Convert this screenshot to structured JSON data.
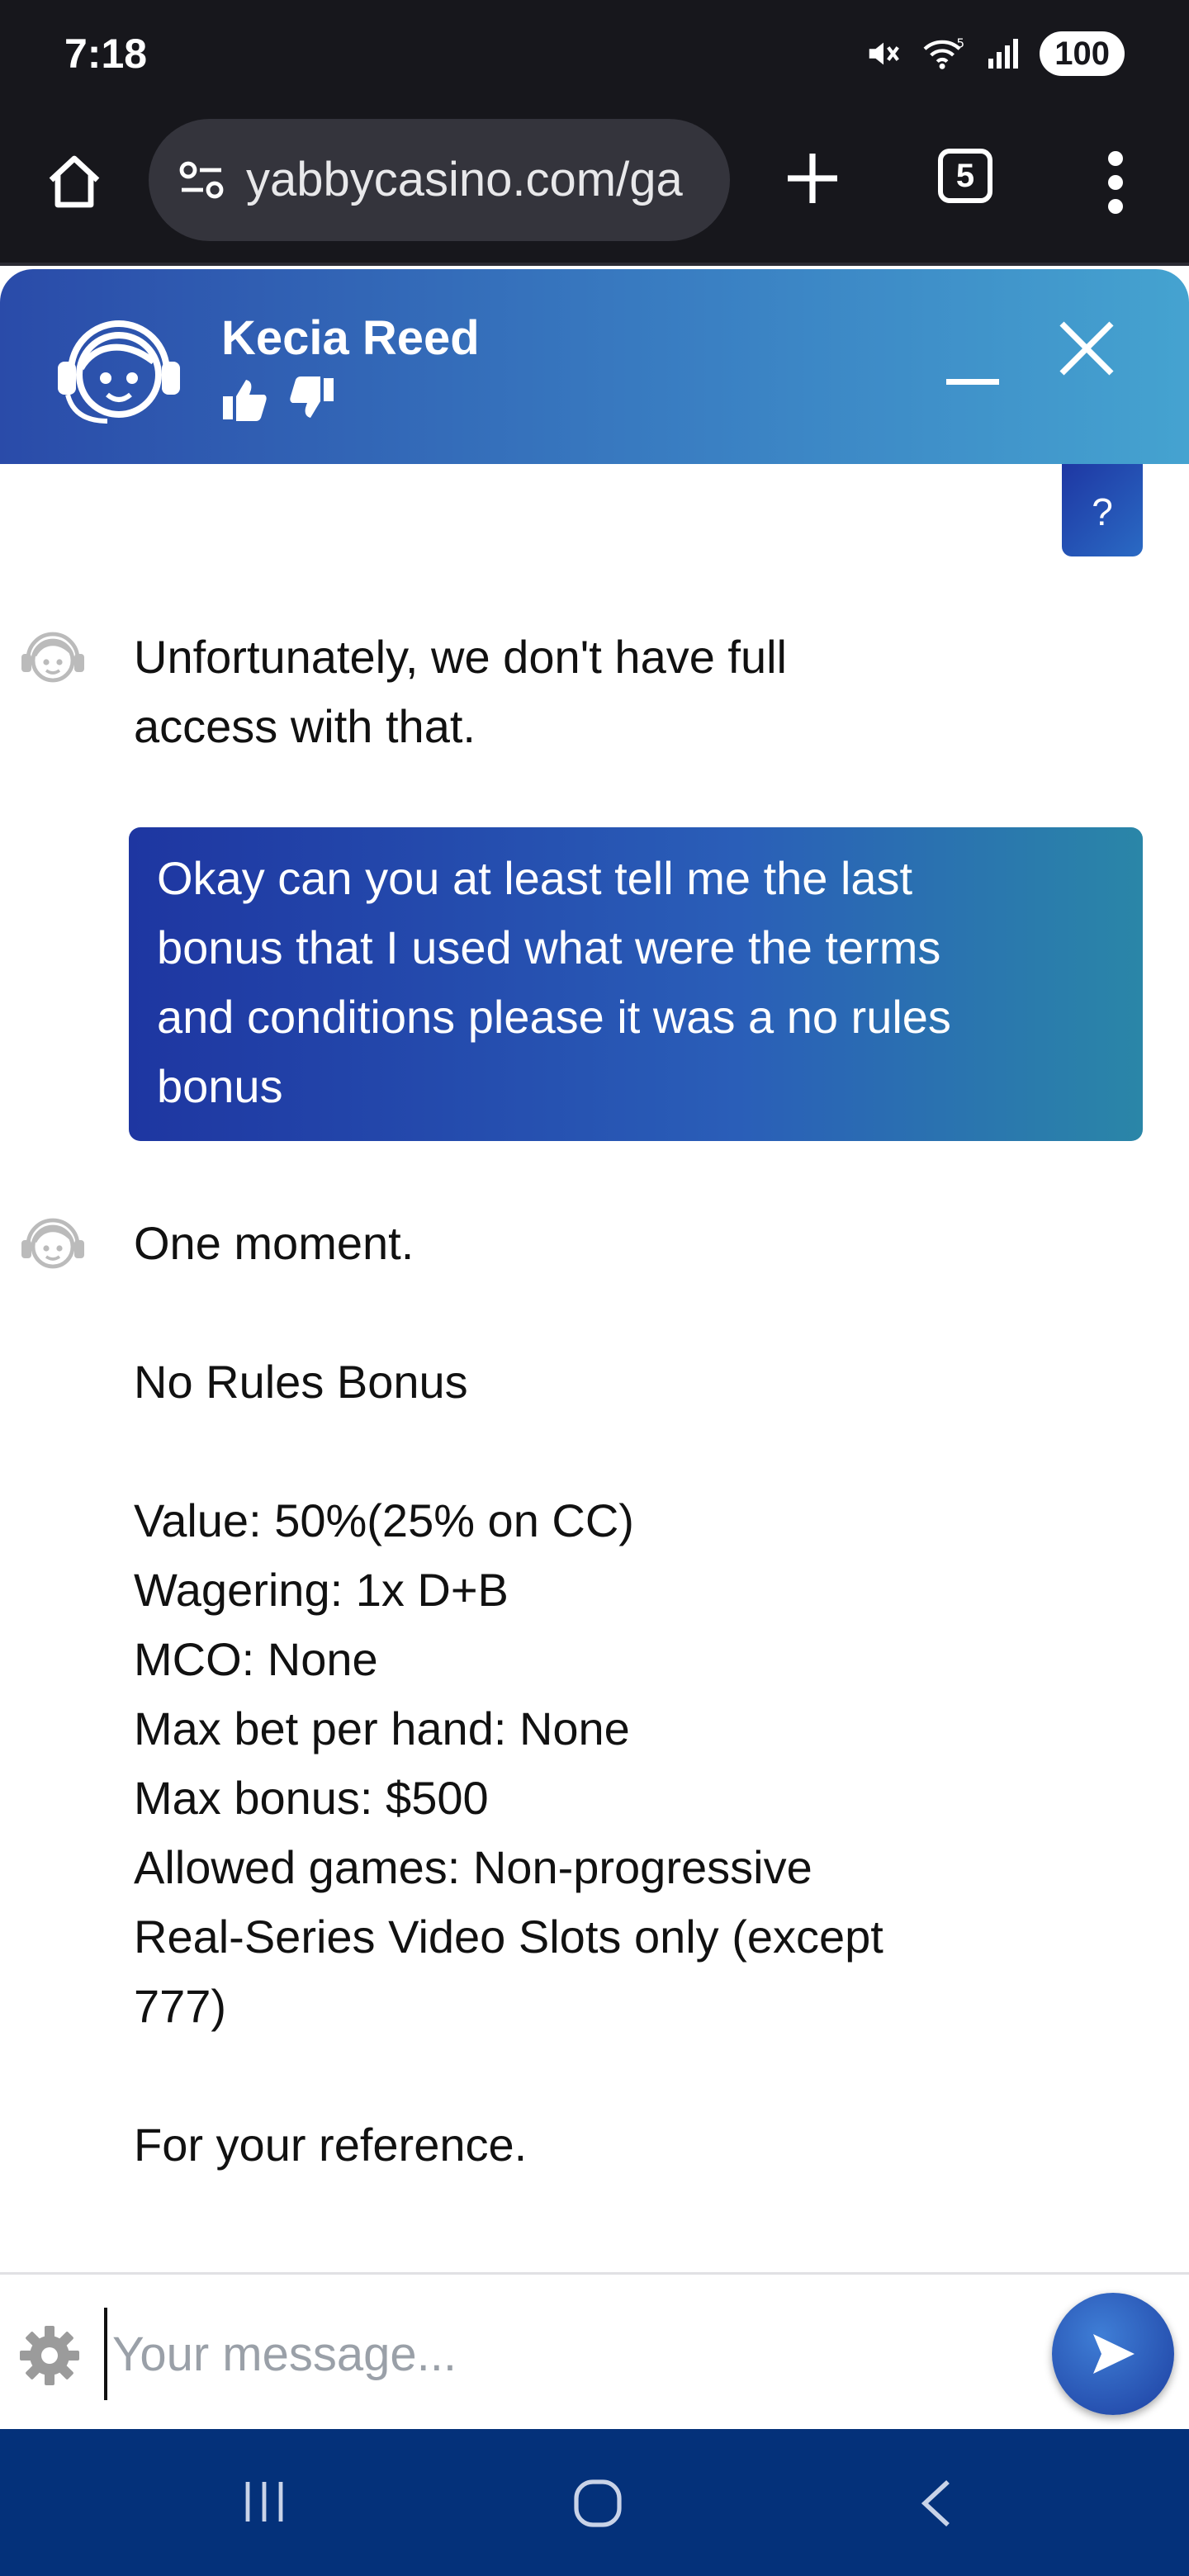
{
  "status_bar": {
    "time": "7:18",
    "battery": "100",
    "wifi_label": "5",
    "icons": [
      "mute-icon",
      "wifi-icon",
      "signal-icon",
      "battery-icon"
    ]
  },
  "browser": {
    "url": "yabbycasino.com/ga",
    "tab_count": "5",
    "icons": [
      "home-icon",
      "site-settings-icon",
      "plus-icon",
      "tabs-icon",
      "more-icon"
    ]
  },
  "chat": {
    "agent_name": "Kecia Reed",
    "header_icons": [
      "agent-avatar-icon",
      "thumbs-up-icon",
      "thumbs-down-icon",
      "minimize-icon",
      "close-icon"
    ],
    "colors": {
      "header_start": "#2a4ba9",
      "header_end": "#45a3d0",
      "user_bubble": "#1e36a1",
      "nav_bar": "#04317a"
    },
    "user_partial_message": "?",
    "messages": {
      "bot_1": [
        "Unfortunately, we don't have full",
        "access with that."
      ],
      "user_1": [
        "Okay can you at least tell me the last",
        "bonus that I used what were the terms",
        "and conditions please it was a no rules",
        "bonus"
      ],
      "bot_2_intro": "One moment.",
      "bot_2_title": "No Rules Bonus",
      "bot_2_terms": [
        "Value: 50%(25% on CC)",
        "Wagering: 1x D+B",
        "MCO: None",
        "Max bet per hand: None",
        "Max bonus: $500",
        "Allowed games: Non-progressive",
        "Real-Series Video Slots only (except",
        "777)"
      ],
      "bot_2_outro": "For your reference."
    },
    "input": {
      "placeholder": "Your message...",
      "value": ""
    }
  },
  "nav": {
    "icons": [
      "recents-icon",
      "home-icon",
      "back-icon"
    ]
  }
}
